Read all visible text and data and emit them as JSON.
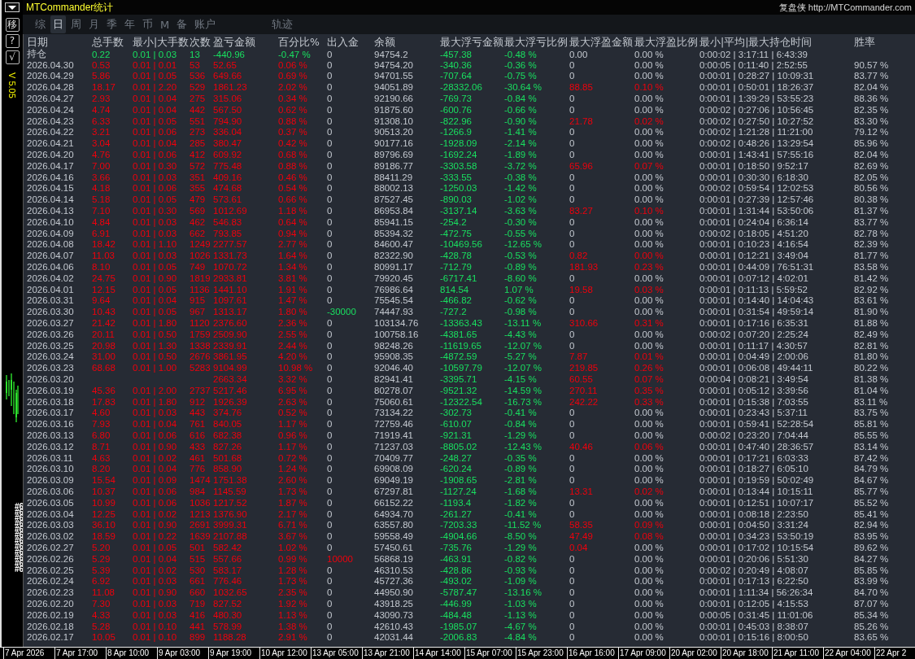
{
  "app_title": "MTCommander统计",
  "site": "复盘侠 http://MTCommander.com",
  "side_buttons": [
    "移",
    "?",
    "√"
  ],
  "version": "V 5.05",
  "chart_labels": [
    "#6",
    "#6",
    "#6",
    "#6",
    "#6",
    "#6",
    "#6",
    "#6",
    "#6",
    "#6",
    "#6",
    "#6"
  ],
  "tabs": [
    {
      "label": "综",
      "selected": false
    },
    {
      "label": "日",
      "selected": true
    },
    {
      "label": "周",
      "selected": false
    },
    {
      "label": "月",
      "selected": false
    },
    {
      "label": "季",
      "selected": false
    },
    {
      "label": "年",
      "selected": false
    },
    {
      "label": "币",
      "selected": false
    },
    {
      "label": "M",
      "selected": false
    },
    {
      "label": "备",
      "selected": false
    },
    {
      "label": "账户",
      "selected": false
    }
  ],
  "trace_tab": {
    "label": "轨迹",
    "selected": false
  },
  "columns": [
    "日期",
    "总手数",
    "最小|大手数",
    "次数",
    "盈亏金额",
    "百分比%",
    "出入金",
    "余额",
    "最大浮亏金额",
    "最大浮亏比例",
    "最大浮盈金额",
    "最大浮盈比例",
    "最小|平均|最大持仓时间",
    "胜率"
  ],
  "rows": [
    {
      "kind": "position",
      "float_gain_on": false,
      "float_gain_pct_on": false,
      "cells": [
        "持仓",
        "0.22",
        "0.01 | 0.03",
        "13",
        "-440.96",
        "-0.47 %",
        "0",
        "94754.2",
        "-457.38",
        "-0.48 %",
        "0.00",
        "0.00 %",
        "0:00:02 | 3:17:11 | 6:43:39"
      ]
    },
    {
      "kind": "day",
      "float_gain_on": false,
      "float_gain_pct_on": false,
      "cells": [
        "2026.04.30",
        "0.53",
        "0.01 | 0.01",
        "53",
        "52.65",
        "0.06 %",
        "0",
        "94754.20",
        "-340.36",
        "-0.36 %",
        "0",
        "0.00 %",
        "0:00:05 | 0:11:40 | 2:52:55",
        "90.57 %"
      ]
    },
    {
      "kind": "day",
      "float_gain_on": false,
      "float_gain_pct_on": false,
      "cells": [
        "2026.04.29",
        "5.86",
        "0.01 | 0.05",
        "536",
        "649.66",
        "0.69 %",
        "0",
        "94701.55",
        "-707.64",
        "-0.75 %",
        "0",
        "0.00 %",
        "0:00:01 | 0:28:27 | 10:09:31",
        "83.77 %"
      ]
    },
    {
      "kind": "day",
      "float_gain_on": true,
      "float_gain_pct_on": true,
      "cells": [
        "2026.04.28",
        "18.17",
        "0.01 | 2.20",
        "529",
        "1861.23",
        "2.02 %",
        "0",
        "94051.89",
        "-28332.06",
        "-30.64 %",
        "88.85",
        "0.10 %",
        "0:00:01 | 0:50:01 | 18:26:37",
        "82.04 %"
      ]
    },
    {
      "kind": "day",
      "float_gain_on": false,
      "float_gain_pct_on": false,
      "cells": [
        "2026.04.27",
        "2.93",
        "0.01 | 0.04",
        "275",
        "315.06",
        "0.34 %",
        "0",
        "92190.66",
        "-769.73",
        "-0.84 %",
        "0",
        "0.00 %",
        "0:00:01 | 1:39:29 | 53:55:23",
        "88.36 %"
      ]
    },
    {
      "kind": "day",
      "float_gain_on": false,
      "float_gain_pct_on": false,
      "cells": [
        "2026.04.24",
        "4.74",
        "0.01 | 0.04",
        "442",
        "567.50",
        "0.62 %",
        "0",
        "91875.60",
        "-600.76",
        "-0.66 %",
        "0",
        "0.00 %",
        "0:00:02 | 0:27:06 | 10:56:45",
        "82.35 %"
      ]
    },
    {
      "kind": "day",
      "float_gain_on": true,
      "float_gain_pct_on": true,
      "cells": [
        "2026.04.23",
        "6.33",
        "0.01 | 0.05",
        "551",
        "794.90",
        "0.88 %",
        "0",
        "91308.10",
        "-822.96",
        "-0.90 %",
        "21.78",
        "0.02 %",
        "0:00:02 | 0:27:50 | 10:27:52",
        "83.30 %"
      ]
    },
    {
      "kind": "day",
      "float_gain_on": false,
      "float_gain_pct_on": false,
      "cells": [
        "2026.04.22",
        "3.21",
        "0.01 | 0.06",
        "273",
        "336.04",
        "0.37 %",
        "0",
        "90513.20",
        "-1266.9",
        "-1.41 %",
        "0",
        "0.00 %",
        "0:00:02 | 1:21:28 | 11:21:00",
        "79.12 %"
      ]
    },
    {
      "kind": "day",
      "float_gain_on": false,
      "float_gain_pct_on": false,
      "cells": [
        "2026.04.21",
        "3.04",
        "0.01 | 0.04",
        "285",
        "380.47",
        "0.42 %",
        "0",
        "90177.16",
        "-1928.09",
        "-2.14 %",
        "0",
        "0.00 %",
        "0:00:02 | 0:48:26 | 13:29:54",
        "85.96 %"
      ]
    },
    {
      "kind": "day",
      "float_gain_on": false,
      "float_gain_pct_on": false,
      "cells": [
        "2026.04.20",
        "4.76",
        "0.01 | 0.06",
        "412",
        "609.92",
        "0.68 %",
        "0",
        "89796.69",
        "-1692.24",
        "-1.89 %",
        "0",
        "0.00 %",
        "0:00:01 | 1:43:41 | 57:55:16",
        "82.04 %"
      ]
    },
    {
      "kind": "day",
      "float_gain_on": true,
      "float_gain_pct_on": true,
      "cells": [
        "2026.04.17",
        "7.00",
        "0.01 | 0.30",
        "572",
        "775.48",
        "0.88 %",
        "0",
        "89186.77",
        "-3303.58",
        "-3.72 %",
        "65.96",
        "0.07 %",
        "0:00:01 | 0:18:50 | 9:52:17",
        "82.69 %"
      ]
    },
    {
      "kind": "day",
      "float_gain_on": false,
      "float_gain_pct_on": false,
      "cells": [
        "2026.04.16",
        "3.66",
        "0.01 | 0.03",
        "351",
        "409.16",
        "0.46 %",
        "0",
        "88411.29",
        "-333.55",
        "-0.38 %",
        "0",
        "0.00 %",
        "0:00:01 | 0:30:30 | 6:18:30",
        "82.05 %"
      ]
    },
    {
      "kind": "day",
      "float_gain_on": false,
      "float_gain_pct_on": false,
      "cells": [
        "2026.04.15",
        "4.18",
        "0.01 | 0.06",
        "355",
        "474.68",
        "0.54 %",
        "0",
        "88002.13",
        "-1250.03",
        "-1.42 %",
        "0",
        "0.00 %",
        "0:00:02 | 0:59:54 | 12:02:53",
        "80.56 %"
      ]
    },
    {
      "kind": "day",
      "float_gain_on": false,
      "float_gain_pct_on": false,
      "cells": [
        "2026.04.14",
        "5.18",
        "0.01 | 0.05",
        "479",
        "573.61",
        "0.66 %",
        "0",
        "87527.45",
        "-890.03",
        "-1.02 %",
        "0",
        "0.00 %",
        "0:00:01 | 0:27:39 | 12:57:46",
        "80.38 %"
      ]
    },
    {
      "kind": "day",
      "float_gain_on": true,
      "float_gain_pct_on": true,
      "cells": [
        "2026.04.13",
        "7.10",
        "0.01 | 0.30",
        "569",
        "1012.69",
        "1.18 %",
        "0",
        "86953.84",
        "-3137.14",
        "-3.63 %",
        "83.27",
        "0.10 %",
        "0:00:01 | 1:31:44 | 53:50:06",
        "81.37 %"
      ]
    },
    {
      "kind": "day",
      "float_gain_on": false,
      "float_gain_pct_on": false,
      "cells": [
        "2026.04.10",
        "4.84",
        "0.01 | 0.03",
        "462",
        "546.83",
        "0.64 %",
        "0",
        "85941.15",
        "-254.2",
        "-0.30 %",
        "0",
        "0.00 %",
        "0:00:01 | 0:24:04 | 6:36:14",
        "83.77 %"
      ]
    },
    {
      "kind": "day",
      "float_gain_on": false,
      "float_gain_pct_on": false,
      "cells": [
        "2026.04.09",
        "6.91",
        "0.01 | 0.03",
        "662",
        "793.85",
        "0.94 %",
        "0",
        "85394.32",
        "-472.75",
        "-0.55 %",
        "0",
        "0.00 %",
        "0:00:02 | 0:18:05 | 4:51:20",
        "82.78 %"
      ]
    },
    {
      "kind": "day",
      "float_gain_on": false,
      "float_gain_pct_on": false,
      "cells": [
        "2026.04.08",
        "18.42",
        "0.01 | 1.10",
        "1249",
        "2277.57",
        "2.77 %",
        "0",
        "84600.47",
        "-10469.56",
        "-12.65 %",
        "0",
        "0.00 %",
        "0:00:01 | 0:10:23 | 4:16:54",
        "82.39 %"
      ]
    },
    {
      "kind": "day",
      "float_gain_on": true,
      "float_gain_pct_on": true,
      "cells": [
        "2026.04.07",
        "11.03",
        "0.01 | 0.03",
        "1026",
        "1331.73",
        "1.64 %",
        "0",
        "82322.90",
        "-428.78",
        "-0.53 %",
        "0.82",
        "0.00 %",
        "0:00:01 | 0:12:21 | 3:49:04",
        "81.77 %"
      ]
    },
    {
      "kind": "day",
      "float_gain_on": true,
      "float_gain_pct_on": true,
      "cells": [
        "2026.04.06",
        "8.10",
        "0.01 | 0.05",
        "749",
        "1070.72",
        "1.34 %",
        "0",
        "80991.17",
        "-712.79",
        "-0.89 %",
        "181.93",
        "0.23 %",
        "0:00:01 | 0:44:09 | 76:51:31",
        "83.58 %"
      ]
    },
    {
      "kind": "day",
      "float_gain_on": false,
      "float_gain_pct_on": false,
      "cells": [
        "2026.04.02",
        "24.75",
        "0.01 | 0.90",
        "1819",
        "2933.81",
        "3.81 %",
        "0",
        "79920.45",
        "-6717.41",
        "-8.60 %",
        "0",
        "0.00 %",
        "0:00:01 | 0:07:12 | 4:02:01",
        "81.42 %"
      ]
    },
    {
      "kind": "day",
      "float_gain_on": true,
      "float_gain_pct_on": true,
      "cells": [
        "2026.04.01",
        "12.15",
        "0.01 | 0.05",
        "1136",
        "1441.10",
        "1.91 %",
        "0",
        "76986.64",
        "814.54",
        "1.07 %",
        "19.58",
        "0.03 %",
        "0:00:01 | 0:11:13 | 5:59:52",
        "82.92 %"
      ]
    },
    {
      "kind": "day",
      "float_gain_on": false,
      "float_gain_pct_on": false,
      "cells": [
        "2026.03.31",
        "9.64",
        "0.01 | 0.04",
        "915",
        "1097.61",
        "1.47 %",
        "0",
        "75545.54",
        "-466.82",
        "-0.62 %",
        "0",
        "0.00 %",
        "0:00:01 | 0:14:40 | 14:04:43",
        "83.61 %"
      ]
    },
    {
      "kind": "day",
      "float_gain_on": false,
      "float_gain_pct_on": false,
      "deposit": {
        "color": "#19e060"
      },
      "cells": [
        "2026.03.30",
        "10.43",
        "0.01 | 0.05",
        "967",
        "1313.17",
        "1.80 %",
        "-30000",
        "74447.93",
        "-727.2",
        "-0.98 %",
        "0",
        "0.00 %",
        "0:00:01 | 0:31:54 | 49:59:14",
        "81.90 %"
      ]
    },
    {
      "kind": "day",
      "float_gain_on": true,
      "float_gain_pct_on": true,
      "cells": [
        "2026.03.27",
        "21.42",
        "0.01 | 1.80",
        "1120",
        "2376.60",
        "2.36 %",
        "0",
        "103134.76",
        "-13363.43",
        "-13.11 %",
        "310.66",
        "0.31 %",
        "0:00:01 | 0:17:16 | 6:35:31",
        "81.88 %"
      ]
    },
    {
      "kind": "day",
      "float_gain_on": false,
      "float_gain_pct_on": false,
      "cells": [
        "2026.03.26",
        "20.11",
        "0.01 | 0.50",
        "1759",
        "2509.90",
        "2.55 %",
        "0",
        "100758.16",
        "-4381.65",
        "-4.43 %",
        "0",
        "0.00 %",
        "0:00:02 | 0:07:20 | 2:25:24",
        "82.49 %"
      ]
    },
    {
      "kind": "day",
      "float_gain_on": false,
      "float_gain_pct_on": false,
      "cells": [
        "2026.03.25",
        "20.98",
        "0.01 | 1.30",
        "1338",
        "2339.91",
        "2.44 %",
        "0",
        "98248.26",
        "-11619.65",
        "-12.07 %",
        "0",
        "0.00 %",
        "0:00:01 | 0:11:17 | 4:30:57",
        "82.81 %"
      ]
    },
    {
      "kind": "day",
      "float_gain_on": true,
      "float_gain_pct_on": true,
      "cells": [
        "2026.03.24",
        "31.00",
        "0.01 | 0.50",
        "2676",
        "3861.95",
        "4.20 %",
        "0",
        "95908.35",
        "-4872.59",
        "-5.27 %",
        "7.87",
        "0.01 %",
        "0:00:01 | 0:04:49 | 2:00:06",
        "81.80 %"
      ]
    },
    {
      "kind": "day",
      "float_gain_on": true,
      "float_gain_pct_on": true,
      "cells": [
        "2026.03.23",
        "68.68",
        "0.01 | 1.00",
        "5283",
        "9104.99",
        "10.98 %",
        "0",
        "92046.40",
        "-10597.79",
        "-12.07 %",
        "219.85",
        "0.26 %",
        "0:00:01 | 0:06:08 | 49:44:11",
        "80.22 %"
      ]
    },
    {
      "kind": "day",
      "float_gain_on": true,
      "float_gain_pct_on": true,
      "cells": [
        "2026.03.20",
        null,
        null,
        null,
        "2663.34",
        "3.32 %",
        "0",
        "82941.41",
        "-3395.71",
        "-4.15 %",
        "60.55",
        "0.07 %",
        "0:00:04 | 0:08:21 | 3:49:54",
        "81.38 %"
      ]
    },
    {
      "kind": "day",
      "float_gain_on": true,
      "float_gain_pct_on": true,
      "cells": [
        "2026.03.19",
        "45.36",
        "0.01 | 2.00",
        "2737",
        "5217.46",
        "6.95 %",
        "0",
        "80278.07",
        "-9521.32",
        "-14.59 %",
        "270.11",
        "0.35 %",
        "0:00:01 | 0:05:12 | 3:39:56",
        "81.04 %"
      ]
    },
    {
      "kind": "day",
      "float_gain_on": true,
      "float_gain_pct_on": true,
      "cells": [
        "2026.03.18",
        "17.83",
        "0.01 | 1.80",
        "912",
        "1926.39",
        "2.63 %",
        "0",
        "75060.61",
        "-12322.54",
        "-16.73 %",
        "242.22",
        "0.33 %",
        "0:00:01 | 0:15:38 | 7:03:55",
        "83.11 %"
      ]
    },
    {
      "kind": "day",
      "float_gain_on": false,
      "float_gain_pct_on": false,
      "cells": [
        "2026.03.17",
        "4.60",
        "0.01 | 0.03",
        "443",
        "374.76",
        "0.52 %",
        "0",
        "73134.22",
        "-302.73",
        "-0.41 %",
        "0",
        "0.00 %",
        "0:00:01 | 0:23:43 | 5:37:11",
        "83.75 %"
      ]
    },
    {
      "kind": "day",
      "float_gain_on": false,
      "float_gain_pct_on": false,
      "cells": [
        "2026.03.16",
        "7.93",
        "0.01 | 0.04",
        "761",
        "840.05",
        "1.17 %",
        "0",
        "72759.46",
        "-610.07",
        "-0.84 %",
        "0",
        "0.00 %",
        "0:00:01 | 0:59:41 | 52:28:54",
        "85.81 %"
      ]
    },
    {
      "kind": "day",
      "float_gain_on": false,
      "float_gain_pct_on": false,
      "cells": [
        "2026.03.13",
        "6.80",
        "0.01 | 0.06",
        "616",
        "682.38",
        "0.96 %",
        "0",
        "71919.41",
        "-921.31",
        "-1.29 %",
        "0",
        "0.00 %",
        "0:00:02 | 0:23:20 | 7:04:44",
        "85.55 %"
      ]
    },
    {
      "kind": "day",
      "float_gain_on": true,
      "float_gain_pct_on": true,
      "cells": [
        "2026.03.12",
        "8.71",
        "0.01 | 0.90",
        "433",
        "827.26",
        "1.17 %",
        "0",
        "71237.03",
        "-8805.02",
        "-12.43 %",
        "40.46",
        "0.06 %",
        "0:00:01 | 0:47:40 | 28:36:57",
        "83.14 %"
      ]
    },
    {
      "kind": "day",
      "float_gain_on": false,
      "float_gain_pct_on": false,
      "cells": [
        "2026.03.11",
        "4.63",
        "0.01 | 0.02",
        "461",
        "501.68",
        "0.72 %",
        "0",
        "70409.77",
        "-248.27",
        "-0.35 %",
        "0",
        "0.00 %",
        "0:00:01 | 0:17:21 | 6:03:33",
        "87.42 %"
      ]
    },
    {
      "kind": "day",
      "float_gain_on": false,
      "float_gain_pct_on": false,
      "cells": [
        "2026.03.10",
        "8.20",
        "0.01 | 0.04",
        "776",
        "858.90",
        "1.24 %",
        "0",
        "69908.09",
        "-620.24",
        "-0.89 %",
        "0",
        "0.00 %",
        "0:00:01 | 0:18:27 | 6:05:10",
        "84.79 %"
      ]
    },
    {
      "kind": "day",
      "float_gain_on": false,
      "float_gain_pct_on": false,
      "cells": [
        "2026.03.09",
        "15.54",
        "0.01 | 0.09",
        "1474",
        "1751.38",
        "2.60 %",
        "0",
        "69049.19",
        "-1908.65",
        "-2.81 %",
        "0",
        "0.00 %",
        "0:00:01 | 0:19:59 | 50:02:49",
        "84.67 %"
      ]
    },
    {
      "kind": "day",
      "float_gain_on": true,
      "float_gain_pct_on": true,
      "cells": [
        "2026.03.06",
        "10.37",
        "0.01 | 0.06",
        "984",
        "1145.59",
        "1.73 %",
        "0",
        "67297.81",
        "-1127.24",
        "-1.68 %",
        "13.31",
        "0.02 %",
        "0:00:01 | 0:13:44 | 10:15:11",
        "85.77 %"
      ]
    },
    {
      "kind": "day",
      "float_gain_on": false,
      "float_gain_pct_on": false,
      "cells": [
        "2026.03.05",
        "10.99",
        "0.01 | 0.06",
        "1036",
        "1217.52",
        "1.87 %",
        "0",
        "66152.22",
        "-1193.4",
        "-1.82 %",
        "0",
        "0.00 %",
        "0:00:01 | 0:12:51 | 10:07:17",
        "85.52 %"
      ]
    },
    {
      "kind": "day",
      "float_gain_on": false,
      "float_gain_pct_on": false,
      "cells": [
        "2026.03.04",
        "12.25",
        "0.01 | 0.02",
        "1213",
        "1376.90",
        "2.17 %",
        "0",
        "64934.70",
        "-261.27",
        "-0.41 %",
        "0",
        "0.00 %",
        "0:00:01 | 0:08:18 | 2:23:50",
        "85.41 %"
      ]
    },
    {
      "kind": "day",
      "float_gain_on": true,
      "float_gain_pct_on": true,
      "cells": [
        "2026.03.03",
        "36.10",
        "0.01 | 0.90",
        "2691",
        "3999.31",
        "6.71 %",
        "0",
        "63557.80",
        "-7203.33",
        "-11.52 %",
        "58.35",
        "0.09 %",
        "0:00:01 | 0:04:50 | 3:31:24",
        "82.94 %"
      ]
    },
    {
      "kind": "day",
      "float_gain_on": true,
      "float_gain_pct_on": true,
      "cells": [
        "2026.03.02",
        "18.59",
        "0.01 | 0.22",
        "1639",
        "2107.88",
        "3.67 %",
        "0",
        "59558.49",
        "-4904.66",
        "-8.50 %",
        "47.49",
        "0.08 %",
        "0:00:01 | 0:34:23 | 53:50:19",
        "83.95 %"
      ]
    },
    {
      "kind": "day",
      "float_gain_on": true,
      "float_gain_pct_on": false,
      "cells": [
        "2026.02.27",
        "5.20",
        "0.01 | 0.05",
        "501",
        "582.42",
        "1.02 %",
        "0",
        "57450.61",
        "-735.76",
        "-1.29 %",
        "0.04",
        "0.00 %",
        "0:00:01 | 0:17:02 | 10:15:54",
        "89.62 %"
      ]
    },
    {
      "kind": "day",
      "float_gain_on": false,
      "float_gain_pct_on": false,
      "deposit": {
        "color": "#f0000c"
      },
      "cells": [
        "2026.02.26",
        "5.29",
        "0.01 | 0.04",
        "515",
        "557.66",
        "0.99 %",
        "10000",
        "56868.19",
        "-463.91",
        "-0.82 %",
        "0",
        "0.00 %",
        "0:00:01 | 0:20:06 | 5:51:30",
        "84.27 %"
      ]
    },
    {
      "kind": "day",
      "float_gain_on": false,
      "float_gain_pct_on": false,
      "cells": [
        "2026.02.25",
        "5.39",
        "0.01 | 0.02",
        "530",
        "583.17",
        "1.28 %",
        "0",
        "46310.53",
        "-428.86",
        "-0.93 %",
        "0",
        "0.00 %",
        "0:00:02 | 0:20:49 | 4:08:07",
        "85.85 %"
      ]
    },
    {
      "kind": "day",
      "float_gain_on": false,
      "float_gain_pct_on": false,
      "cells": [
        "2026.02.24",
        "6.92",
        "0.01 | 0.03",
        "661",
        "776.46",
        "1.73 %",
        "0",
        "45727.36",
        "-493.02",
        "-1.09 %",
        "0",
        "0.00 %",
        "0:00:01 | 0:17:13 | 6:22:50",
        "83.99 %"
      ]
    },
    {
      "kind": "day",
      "float_gain_on": false,
      "float_gain_pct_on": false,
      "cells": [
        "2026.02.23",
        "11.08",
        "0.01 | 0.90",
        "660",
        "1032.65",
        "2.35 %",
        "0",
        "44950.90",
        "-5787.47",
        "-13.16 %",
        "0",
        "0.00 %",
        "0:00:01 | 1:11:34 | 56:26:34",
        "84.70 %"
      ]
    },
    {
      "kind": "day",
      "float_gain_on": false,
      "float_gain_pct_on": false,
      "cells": [
        "2026.02.20",
        "7.30",
        "0.01 | 0.03",
        "719",
        "827.52",
        "1.92 %",
        "0",
        "43918.25",
        "-446.99",
        "-1.03 %",
        "0",
        "0.00 %",
        "0:00:01 | 0:12:05 | 4:15:53",
        "87.07 %"
      ]
    },
    {
      "kind": "day",
      "float_gain_on": false,
      "float_gain_pct_on": false,
      "cells": [
        "2026.02.19",
        "4.33",
        "0.01 | 0.03",
        "416",
        "480.30",
        "1.13 %",
        "0",
        "43090.73",
        "-484.48",
        "-1.13 %",
        "0",
        "0.00 %",
        "0:00:05 | 0:31:45 | 11:01:06",
        "85.34 %"
      ]
    },
    {
      "kind": "day",
      "float_gain_on": false,
      "float_gain_pct_on": false,
      "cells": [
        "2026.02.18",
        "5.28",
        "0.01 | 0.10",
        "441",
        "578.99",
        "1.38 %",
        "0",
        "42610.43",
        "-1985.07",
        "-4.67 %",
        "0",
        "0.00 %",
        "0:00:01 | 0:45:03 | 8:38:07",
        "85.26 %"
      ]
    },
    {
      "kind": "day",
      "float_gain_on": false,
      "float_gain_pct_on": false,
      "cells": [
        "2026.02.17",
        "10.05",
        "0.01 | 0.10",
        "899",
        "1188.28",
        "2.91 %",
        "0",
        "42031.44",
        "-2006.83",
        "-4.84 %",
        "0",
        "0.00 %",
        "0:00:01 | 0:15:16 | 8:00:50",
        "83.65 %"
      ]
    }
  ],
  "time_axis": [
    "7 Apr 2026",
    "7 Apr 17:00",
    "8 Apr 10:00",
    "9 Apr 03:00",
    "9 Apr 19:00",
    "10 Apr 12:00",
    "13 Apr 05:00",
    "13 Apr 21:00",
    "14 Apr 14:00",
    "15 Apr 07:00",
    "15 Apr 23:00",
    "16 Apr 16:00",
    "17 Apr 09:00",
    "20 Apr 02:00",
    "20 Apr 18:00",
    "21 Apr 11:00",
    "22 Apr 04:00",
    "22 Apr 2"
  ]
}
